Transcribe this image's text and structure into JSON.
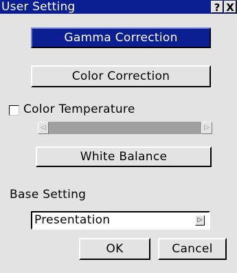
{
  "window": {
    "title": "User Setting",
    "help_glyph": "?",
    "close_glyph": "X"
  },
  "buttons": {
    "gamma": "Gamma Correction",
    "color": "Color Correction",
    "white_balance": "White Balance",
    "ok": "OK",
    "cancel": "Cancel"
  },
  "color_temperature": {
    "label": "Color Temperature",
    "checked": false,
    "left_arrow": "◁",
    "right_arrow": "▷"
  },
  "base_setting": {
    "label": "Base Setting",
    "value": "Presentation",
    "arrow": "▷"
  },
  "colors": {
    "title_bar": "#0b1e92",
    "selected_button": "#0b1e92",
    "face": "#e3e3e3",
    "slider_track": "#a0a0a0"
  }
}
